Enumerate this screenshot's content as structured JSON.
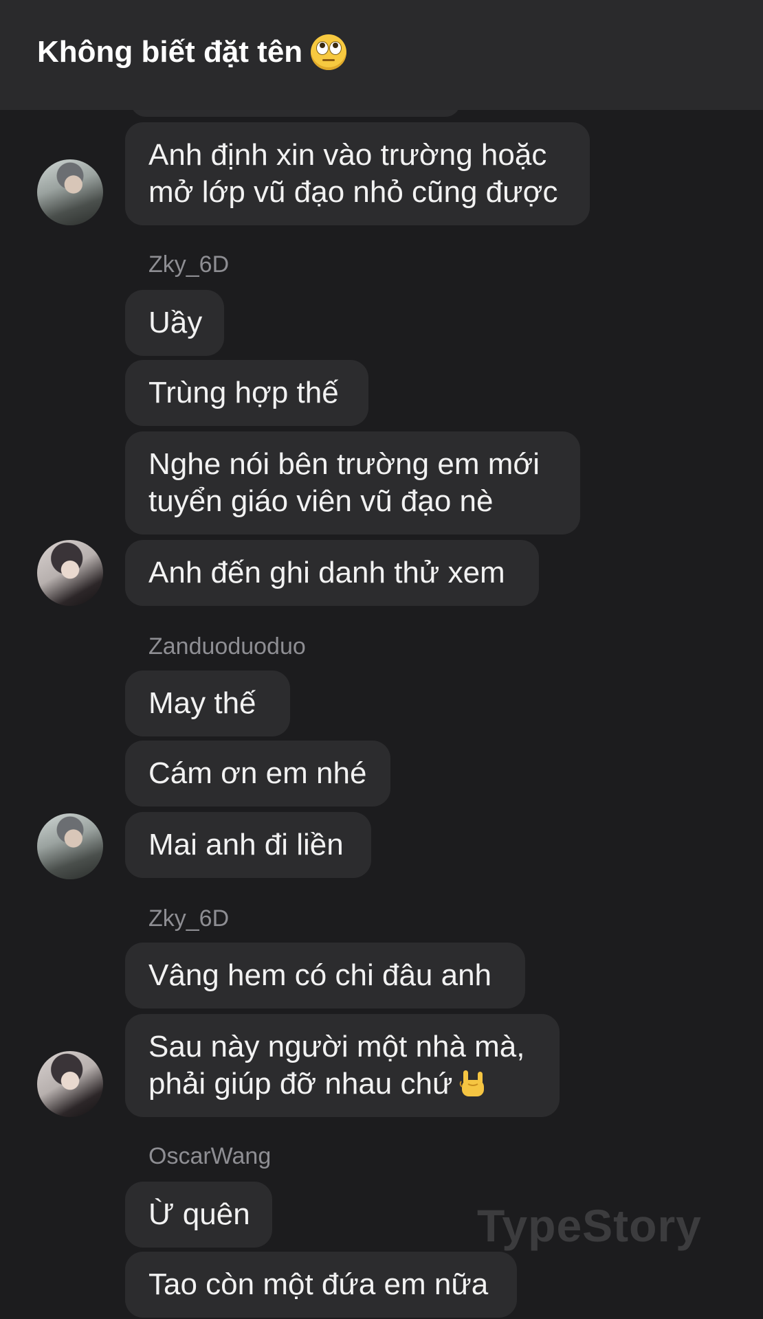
{
  "header": {
    "title": "Không biết đặt tên",
    "emoji_icon": "face-with-rolling-eyes-emoji"
  },
  "messages": [
    {
      "text_lines": [
        "Anh định xin vào trường hoặc",
        "mở lớp vũ đạo nhỏ cũng được"
      ]
    },
    {
      "sender": "Zky_6D"
    },
    {
      "text": "Uầy"
    },
    {
      "text": "Trùng hợp thế"
    },
    {
      "text_lines": [
        "Nghe nói bên trường em mới",
        "tuyển giáo viên vũ đạo nè"
      ]
    },
    {
      "text": "Anh đến ghi danh thử xem"
    },
    {
      "sender": "Zanduoduoduo"
    },
    {
      "text": "May thế"
    },
    {
      "text": "Cám ơn em nhé"
    },
    {
      "text": "Mai anh đi liền"
    },
    {
      "sender": "Zky_6D"
    },
    {
      "text": "Vâng hem có chi đâu anh"
    },
    {
      "text_lines": [
        "Sau này người một nhà mà,",
        "phải giúp đỡ nhau chứ"
      ],
      "emoji_icon": "sign-of-the-horns-emoji"
    },
    {
      "sender": "OscarWang"
    },
    {
      "text": "Ừ quên"
    },
    {
      "text": "Tao còn một đứa em nữa"
    }
  ],
  "watermark": "TypeStory",
  "colors": {
    "background": "#1c1c1e",
    "header": "#2a2a2c",
    "bubble": "#2c2c2e",
    "text": "#f2f2f2",
    "sender_label": "#8e8e93"
  }
}
